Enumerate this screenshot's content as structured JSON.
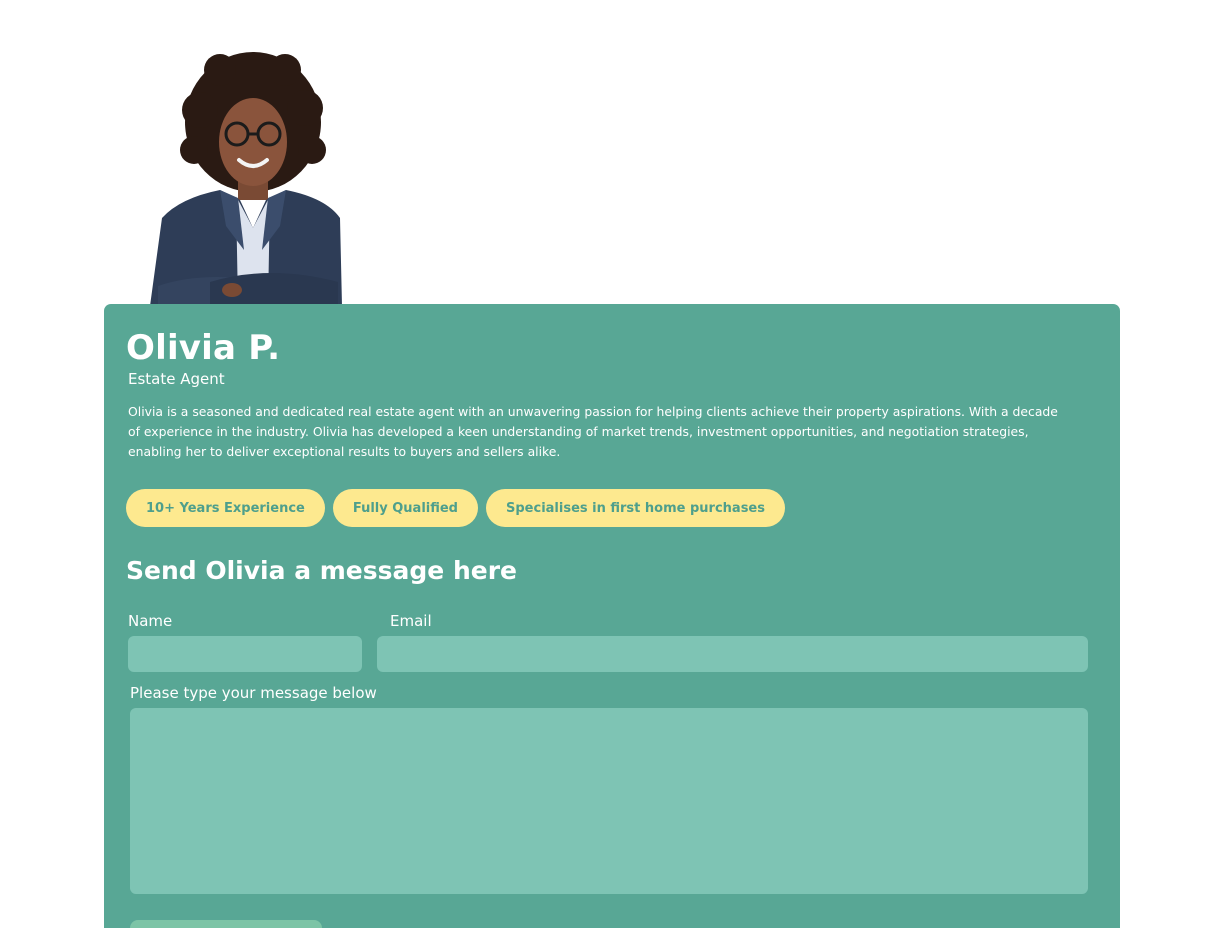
{
  "agent": {
    "name": "Olivia P.",
    "role": "Estate Agent",
    "bio": "Olivia is a seasoned and dedicated real estate agent with an unwavering passion for helping clients achieve their property aspirations. With a decade of experience in the industry. Olivia has developed a keen understanding of market trends, investment opportunities, and negotiation strategies, enabling her to deliver exceptional results to buyers and sellers alike.",
    "photo": "agent-portrait",
    "badges": [
      "10+ Years Experience",
      "Fully Qualified",
      "Specialises in first home purchases"
    ]
  },
  "form": {
    "title": "Send Olivia a message here",
    "name_label": "Name",
    "name_value": "",
    "email_label": "Email",
    "email_value": "",
    "message_label": "Please type your message below",
    "message_value": ""
  },
  "colors": {
    "card_background": "#58a795",
    "input_background": "#7ec4b4",
    "badge_background": "#fde98f",
    "badge_text": "#4e9f8c",
    "text": "#ffffff"
  }
}
